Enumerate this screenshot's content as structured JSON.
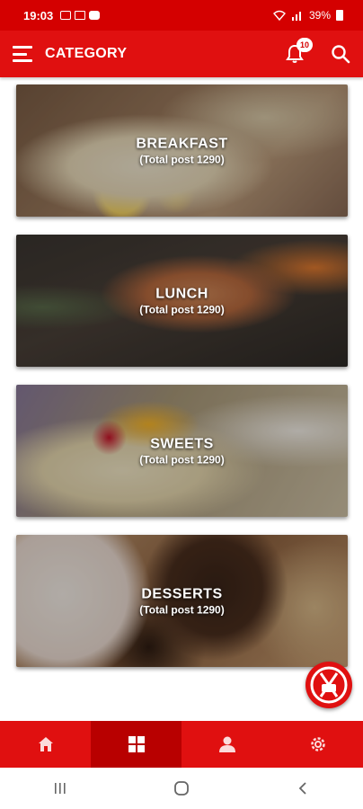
{
  "status_bar": {
    "time": "19:03",
    "battery": "39%"
  },
  "app_bar": {
    "title": "CATEGORY",
    "notification_count": "10"
  },
  "categories": [
    {
      "title": "BREAKFAST",
      "count_text": "(Total post 1290)"
    },
    {
      "title": "LUNCH",
      "count_text": "(Total post 1290)"
    },
    {
      "title": "SWEETS",
      "count_text": "(Total post 1290)"
    },
    {
      "title": "DESSERTS",
      "count_text": "(Total post 1290)"
    }
  ],
  "bottom_nav": [
    {
      "icon": "home-icon",
      "active": false
    },
    {
      "icon": "grid-icon",
      "active": true
    },
    {
      "icon": "profile-icon",
      "active": false
    },
    {
      "icon": "settings-icon",
      "active": false
    }
  ],
  "colors": {
    "primary": "#e01010",
    "status_bar": "#d40000",
    "nav_active": "#b80000"
  }
}
